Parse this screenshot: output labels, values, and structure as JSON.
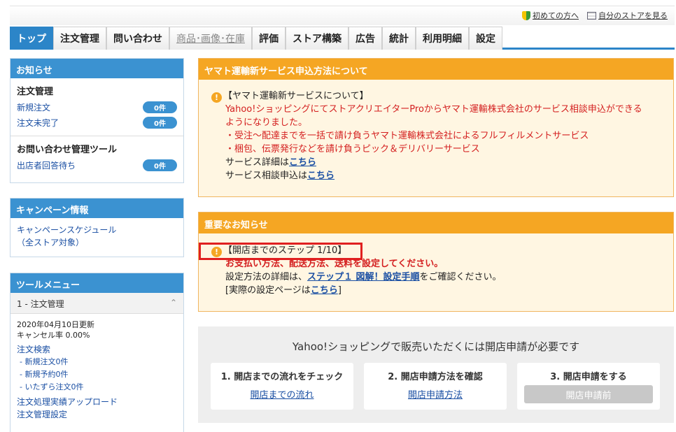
{
  "header": {
    "link_first": "初めての方へ",
    "link_store": "自分のストアを見る"
  },
  "nav": {
    "tabs": [
      "トップ",
      "注文管理",
      "問い合わせ",
      "商品･画像･在庫",
      "評価",
      "ストア構築",
      "広告",
      "統計",
      "利用明細",
      "設定"
    ],
    "active": "トップ"
  },
  "news": {
    "title": "お知らせ",
    "order_title": "注文管理",
    "new_order": "新規注文",
    "unfinished": "注文未完了",
    "count": "0件",
    "inquiry_title": "お問い合わせ管理ツール",
    "awaiting_reply": "出店者回答待ち"
  },
  "campaign": {
    "title": "キャンペーン情報",
    "schedule": "キャンペーンスケジュール",
    "all_stores": "（全ストア対象）"
  },
  "tools": {
    "title": "ツールメニュー",
    "section": "1 - 注文管理",
    "updated": "2020年04月10日更新",
    "cancel_rate": "キャンセル率 0.00%",
    "order_search": "注文検索",
    "new_orders": "- 新規注文0件",
    "new_reserve": "- 新規予約0件",
    "mischief": "- いたずら注文0件",
    "upload": "注文処理実績アップロード",
    "settings": "注文管理設定"
  },
  "yamato": {
    "title": "ヤマト運輸新サービス申込方法について",
    "heading": "【ヤマト運輸新サービスについて】",
    "line1": "Yahoo!ショッピングにてストアクリエイターProからヤマト運輸株式会社のサービス相談申込ができる",
    "line2": "ようになりました。",
    "line3": "・受注～配達までを一括で請け負うヤマト運輸株式会社によるフルフィルメントサービス",
    "line4": "・梱包、伝票発行などを請け負うピック＆デリバリーサービス",
    "detail_prefix": "サービス詳細は",
    "consult_prefix": "サービス相談申込は",
    "here": "こちら"
  },
  "important": {
    "title": "重要なお知らせ",
    "step": "【開店までのステップ  1/10】",
    "headline": "お支払い方法、配送方法、送料を設定してください。",
    "detail_prefix": "設定方法の詳細は、",
    "guide_link": "ステップ１ 図解！設定手順",
    "detail_suffix": "をご確認ください。",
    "actual_prefix": "[実際の設定ページは",
    "here": "こちら",
    "actual_suffix": "]"
  },
  "apply": {
    "title": "Yahoo!ショッピングで販売いただくには開店申請が必要です",
    "card1_title": "1. 開店までの流れをチェック",
    "card1_link": "開店までの流れ",
    "card2_title": "2. 開店申請方法を確認",
    "card2_link": "開店申請方法",
    "card3_title": "3. 開店申請をする",
    "card3_button": "開店申請前"
  }
}
